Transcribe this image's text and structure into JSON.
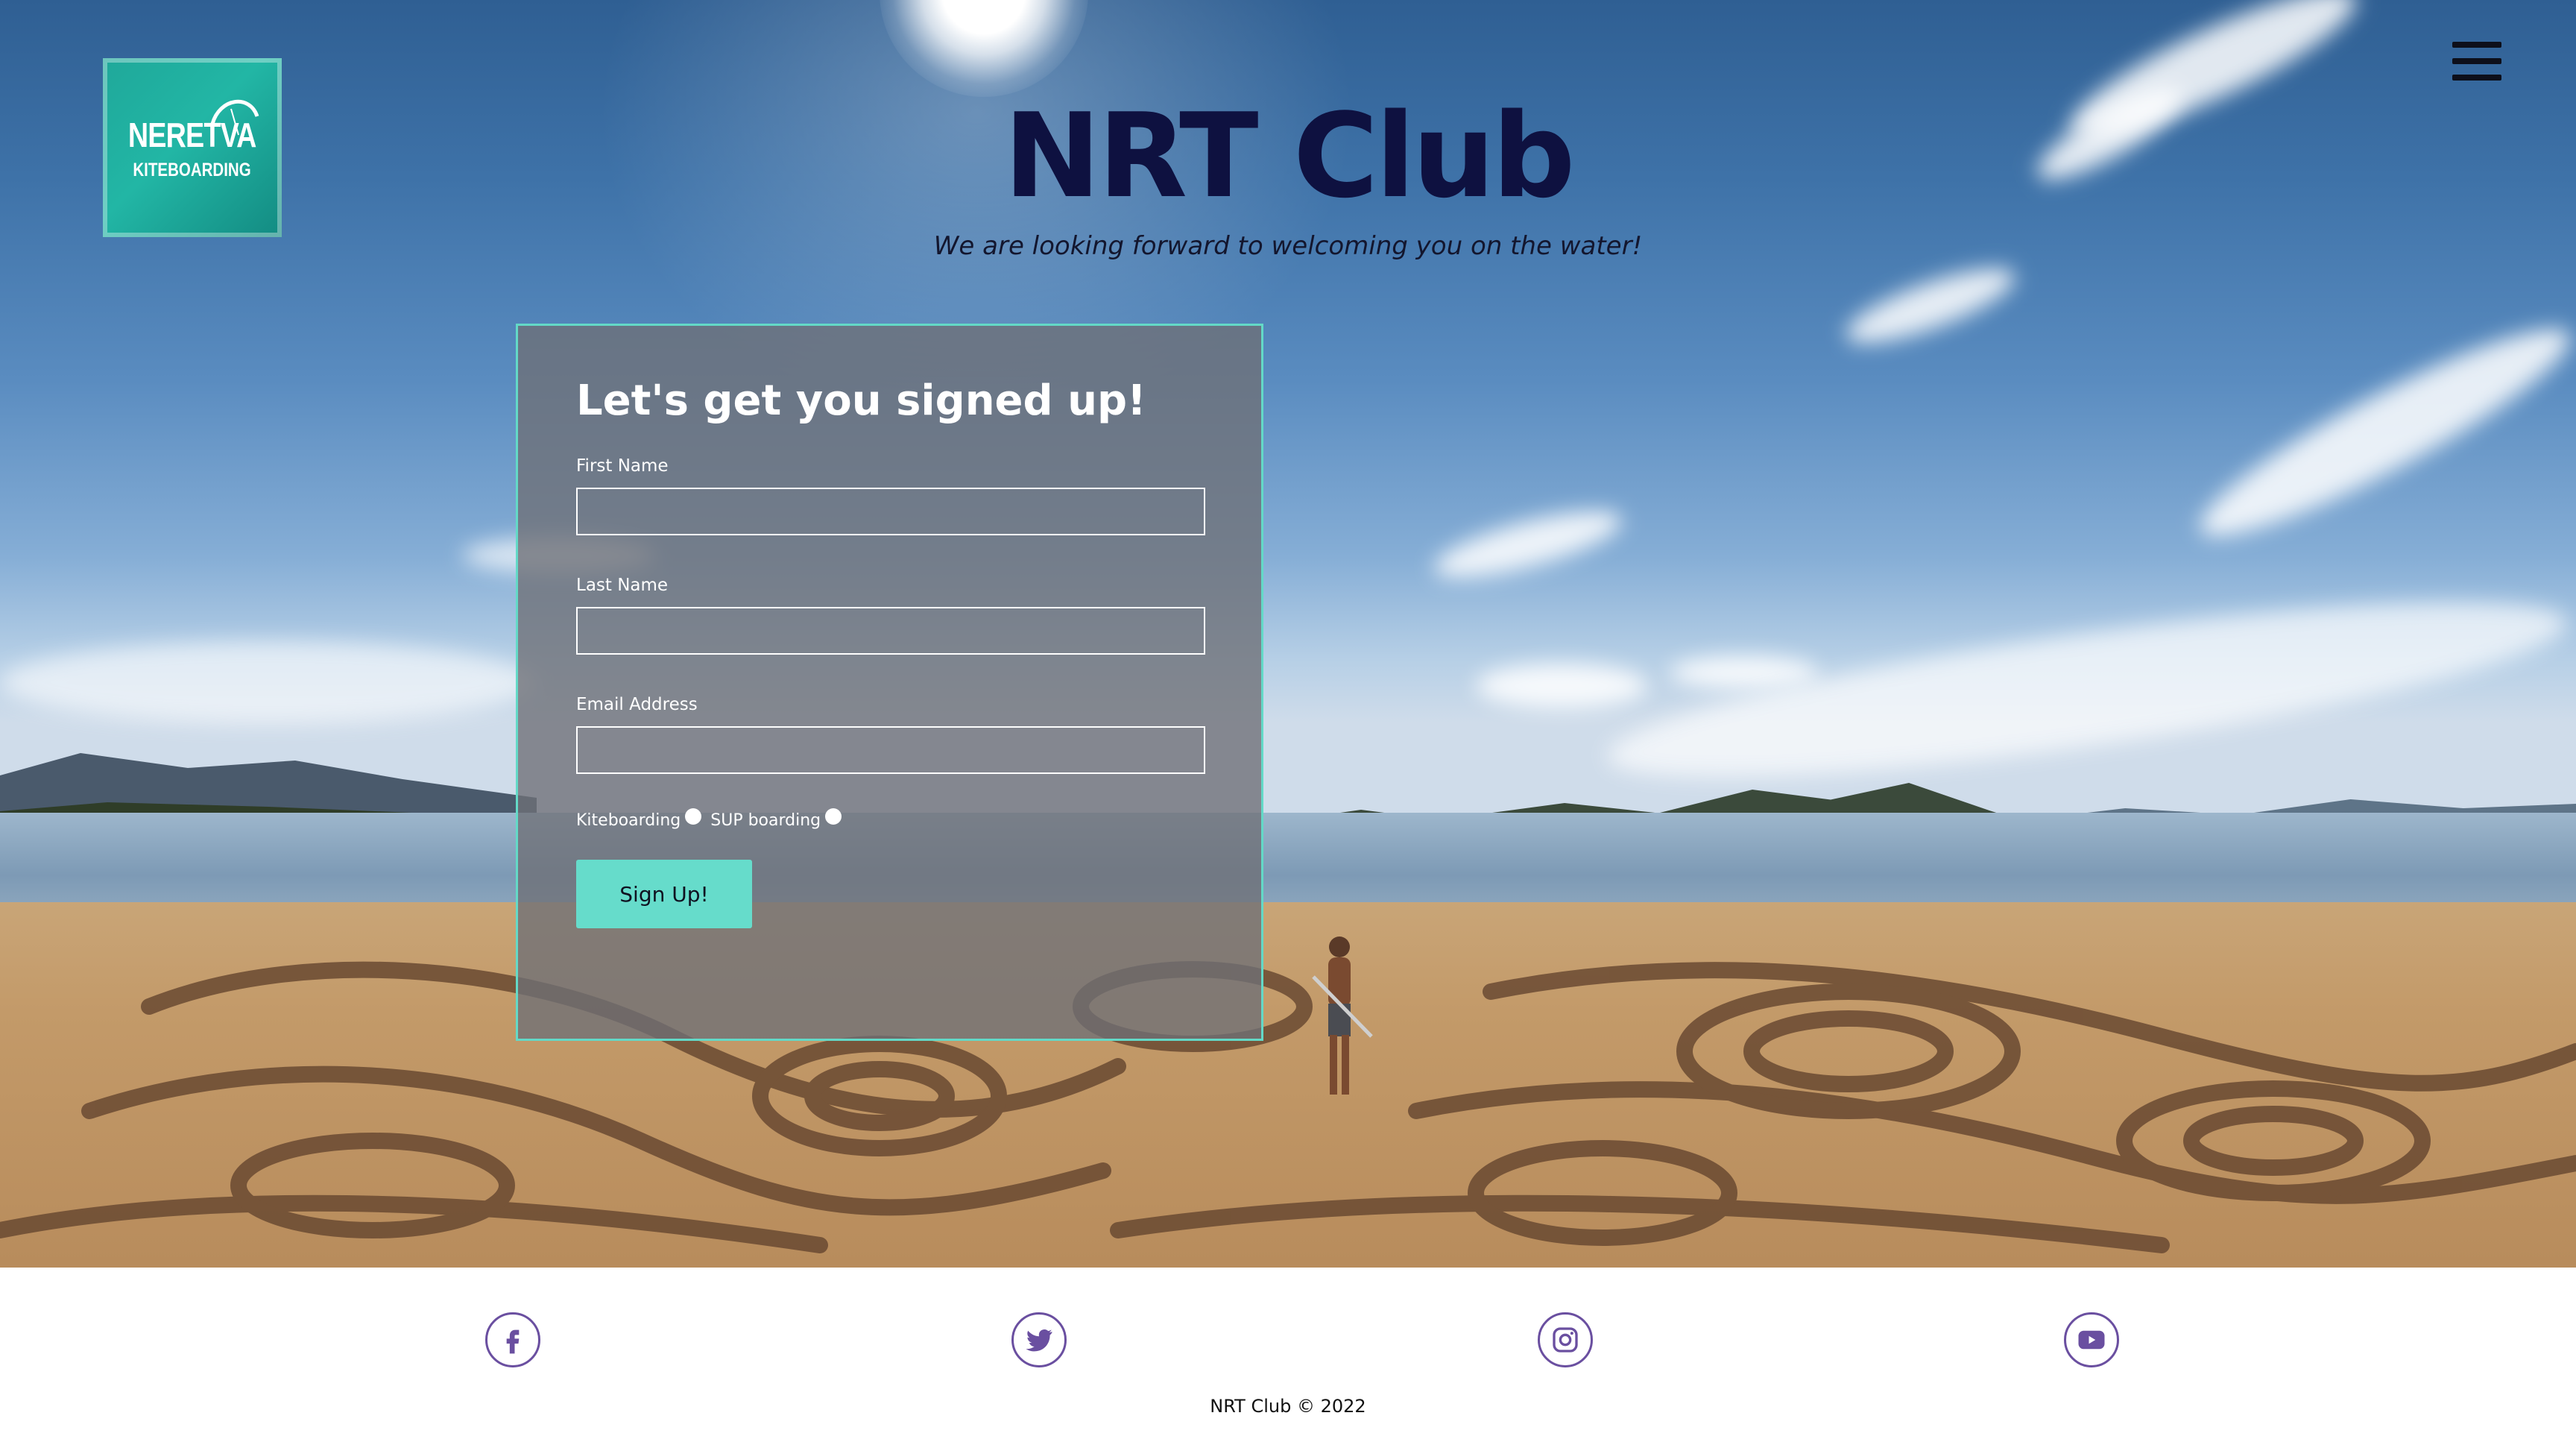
{
  "header": {
    "logo": {
      "line1": "NERETVA",
      "line2": "KITEBOARDING"
    },
    "title": "NRT Club",
    "subtitle": "We are looking forward to welcoming you on the water!",
    "menu_icon": "hamburger-menu-icon"
  },
  "form": {
    "title": "Let's get you signed up!",
    "fields": [
      {
        "label": "First Name",
        "value": "",
        "placeholder": ""
      },
      {
        "label": "Last Name",
        "value": "",
        "placeholder": ""
      },
      {
        "label": "Email Address",
        "value": "",
        "placeholder": ""
      }
    ],
    "options": [
      {
        "label": "Kiteboarding"
      },
      {
        "label": "SUP boarding"
      }
    ],
    "submit_label": "Sign Up!"
  },
  "footer": {
    "social": [
      {
        "icon": "facebook-icon"
      },
      {
        "icon": "twitter-icon"
      },
      {
        "icon": "instagram-icon"
      },
      {
        "icon": "youtube-icon"
      }
    ],
    "copyright": "NRT Club © 2022"
  },
  "colors": {
    "title": "#0e1140",
    "accent": "#66dccb",
    "card_border": "#63d9c7",
    "social": "#6a4fa0"
  }
}
